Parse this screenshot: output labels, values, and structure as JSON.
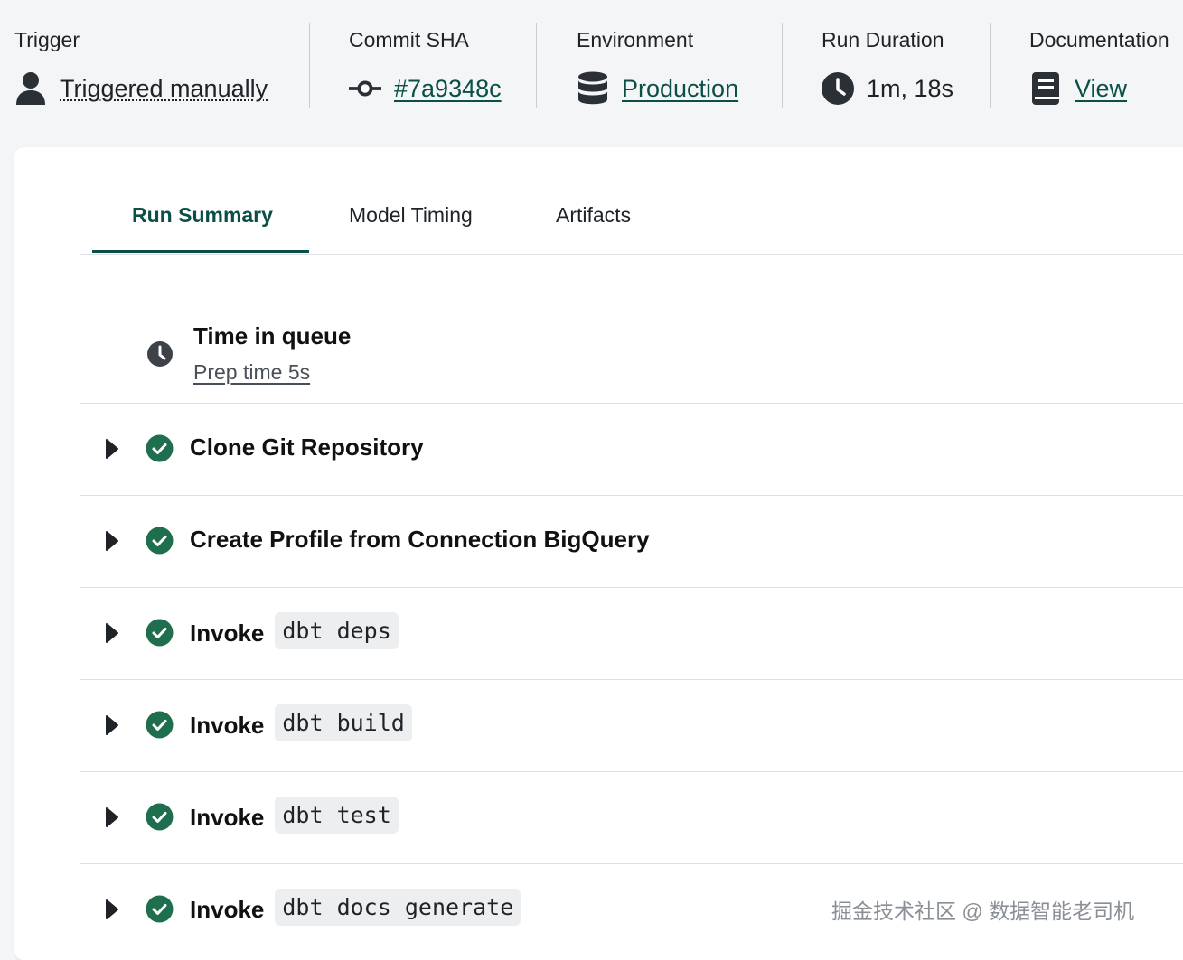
{
  "meta": {
    "trigger": {
      "label": "Trigger",
      "value": "Triggered manually",
      "icon": "user-icon"
    },
    "commit": {
      "label": "Commit SHA",
      "value": "#7a9348c",
      "icon": "commit-icon"
    },
    "environment": {
      "label": "Environment",
      "value": "Production",
      "icon": "database-icon"
    },
    "duration": {
      "label": "Run Duration",
      "value": "1m, 18s",
      "icon": "clock-icon"
    },
    "docs": {
      "label": "Documentation",
      "value": "View",
      "icon": "book-icon"
    }
  },
  "tabs": [
    {
      "label": "Run Summary",
      "active": true
    },
    {
      "label": "Model Timing",
      "active": false
    },
    {
      "label": "Artifacts",
      "active": false
    }
  ],
  "queue": {
    "title": "Time in queue",
    "subtitle": "Prep time 5s"
  },
  "steps": [
    {
      "title": "Clone Git Repository",
      "code": "",
      "status": "success"
    },
    {
      "title": "Create Profile from Connection BigQuery",
      "code": "",
      "status": "success"
    },
    {
      "title": "Invoke",
      "code": "dbt deps",
      "status": "success"
    },
    {
      "title": "Invoke",
      "code": "dbt build",
      "status": "success"
    },
    {
      "title": "Invoke",
      "code": "dbt test",
      "status": "success"
    },
    {
      "title": "Invoke",
      "code": "dbt docs generate",
      "status": "success"
    }
  ],
  "watermark": "掘金技术社区 @ 数据智能老司机",
  "colors": {
    "accent": "#0b4f47",
    "success": "#1f6f4f",
    "icon_dark": "#2b2f36"
  }
}
